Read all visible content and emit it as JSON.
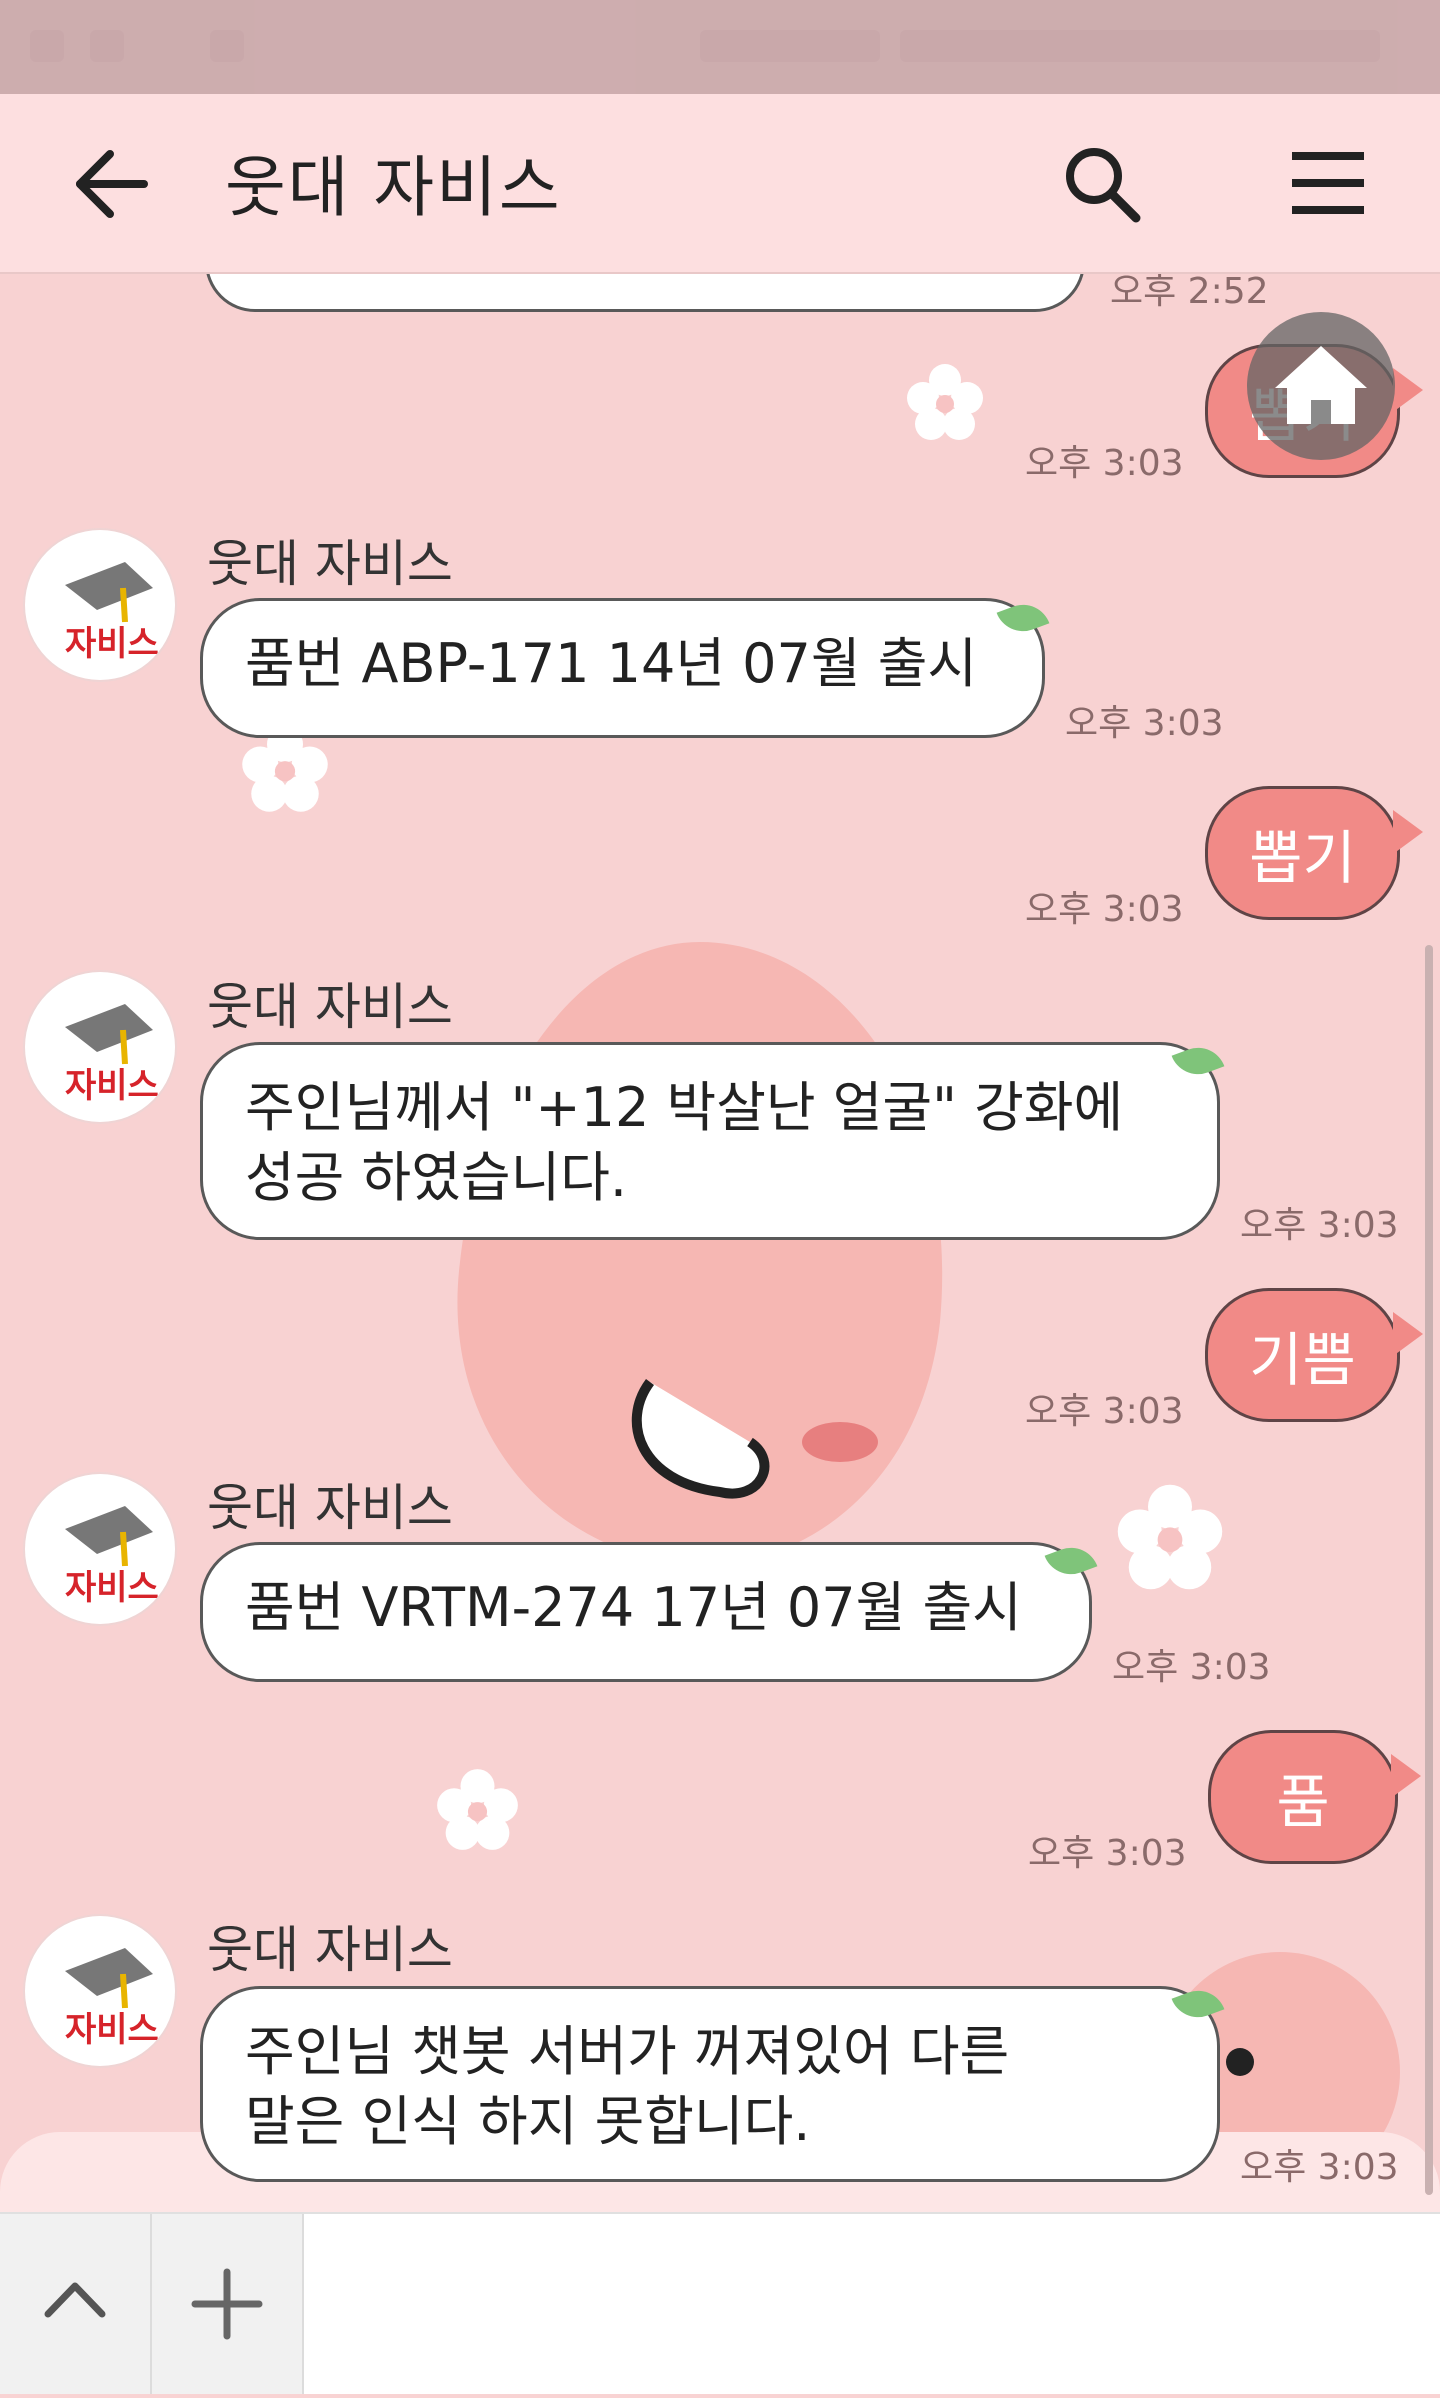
{
  "header": {
    "title": "웃대 자비스"
  },
  "bot": {
    "name": "웃대 자비스",
    "avatar_text": "자비스"
  },
  "messages": [
    {
      "from": "me",
      "text": "뽑기",
      "time": "오후 3:03"
    },
    {
      "from": "bot",
      "text": "품번 ABP-171 14년 07월 출시",
      "time": "오후 3:03"
    },
    {
      "from": "me",
      "text": "뽑기",
      "time": "오후 3:03"
    },
    {
      "from": "bot",
      "lines": [
        "주인님께서 \"+12 박살난 얼굴\" 강화에",
        "성공 하였습니다."
      ],
      "time": "오후 3:03"
    },
    {
      "from": "me",
      "text": "기쁨",
      "time": "오후 3:03"
    },
    {
      "from": "bot",
      "text": "품번 VRTM-274 17년 07월 출시",
      "time": "오후 3:03"
    },
    {
      "from": "me",
      "text": "품",
      "time": "오후 3:03"
    },
    {
      "from": "bot",
      "lines": [
        "주인님 챗봇 서버가 꺼져있어 다른",
        "말은 인식 하지 못합니다."
      ],
      "time": "오후 3:03"
    }
  ],
  "partial_top_time": "오후 2:52",
  "colors": {
    "background": "#f8d2d2",
    "header": "#fddfe0",
    "my_bubble": "#f18a87",
    "bot_bubble": "#ffffff"
  },
  "icons": {
    "back": "arrow-left-icon",
    "search": "search-icon",
    "menu": "hamburger-menu-icon",
    "home": "home-icon",
    "expand": "chevron-up-icon",
    "add": "plus-icon"
  }
}
